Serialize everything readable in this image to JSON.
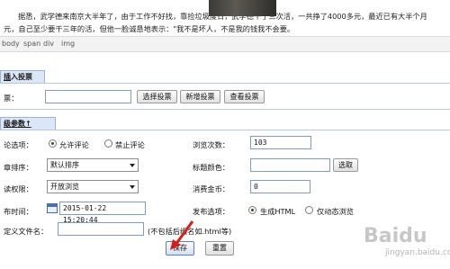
{
  "editor": {
    "line1": "据悉，武学德来南京大半年了，由于工作不好找，靠捡垃圾度日，武学德干了三次活，一共挣了4000多元，最近已有大半个月",
    "line2": "元，自己至少要干三年的活，但他一脸诚恳地表示：\"我不是坏人，不是我的钱我不会要。"
  },
  "path": [
    "body",
    "span",
    "div",
    "img"
  ],
  "vote_tab": {
    "prefix": "插",
    "rest": "入投票"
  },
  "vote": {
    "label": "票：",
    "value": "",
    "btn_select": "选择投票",
    "btn_new": "新增投票",
    "btn_view": "查看投票"
  },
  "advanced_tab": "级参数↑",
  "form": {
    "comment_label": "论选项：",
    "comment_opt_allow": "允许评论",
    "comment_opt_forbid": "禁止评论",
    "views_label": "浏览次数：",
    "views_value": "103",
    "sort_label": "章排序：",
    "sort_value": "默认排序",
    "title_color_label": "标题颜色：",
    "title_color_value": "",
    "pick_button": "选取",
    "read_label": "读权限：",
    "read_value": "开放浏览",
    "coin_label": "消费金币：",
    "coin_value": "0",
    "time_label": "布时间：",
    "time_value": "2015-01-22 15:20:44",
    "publish_label": "发布选项：",
    "publish_opt_html": "生成HTML",
    "publish_opt_dynamic": "仅动态浏览",
    "filename_label": "定义文件名：",
    "filename_value": "",
    "filename_hint": "(不包括后缀名如.html等)"
  },
  "actions": {
    "save": "保存",
    "reset": "重置"
  },
  "watermark": {
    "main": "Baidu",
    "sub": "jingyan.baidu.com"
  },
  "colors": {
    "tab_bg": "#dbe6f6",
    "border": "#7f9db9",
    "cursor": "#d81d1d"
  }
}
